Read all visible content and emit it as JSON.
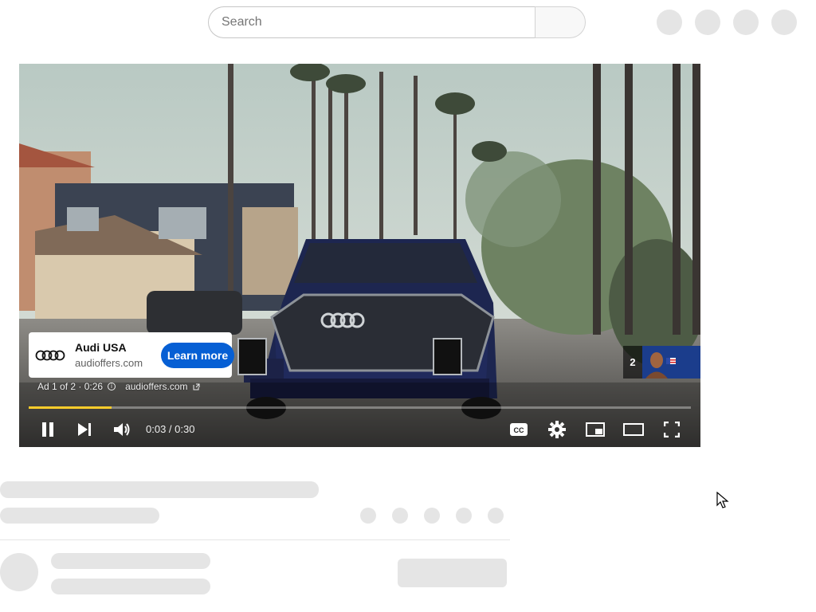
{
  "search": {
    "placeholder": "Search"
  },
  "ad": {
    "advertiser": "Audi USA",
    "domain": "audioffers.com",
    "cta_label": "Learn more",
    "meta": "Ad 1 of 2 · 0:26",
    "meta_domain": "audioffers.com",
    "next_ad_count": "2"
  },
  "player": {
    "time_display": "0:03 / 0:30",
    "progress": 0.125,
    "progress_color": "#fccc2b",
    "accent_button_color": "#065fd4",
    "icons": [
      "pause-icon",
      "next-icon",
      "volume-icon",
      "captions-icon",
      "settings-icon",
      "miniplayer-icon",
      "theater-icon",
      "fullscreen-icon"
    ]
  }
}
